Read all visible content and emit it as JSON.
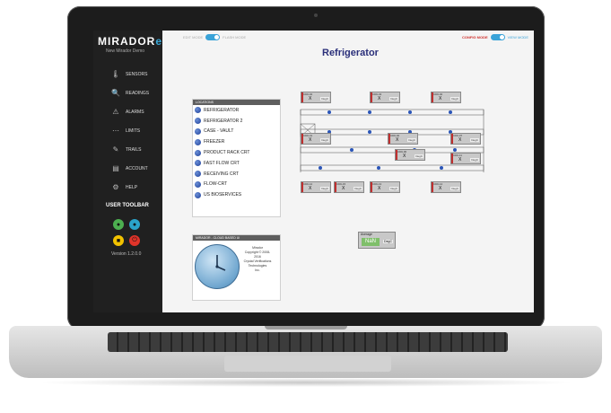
{
  "app": {
    "logo_left": "MIR",
    "logo_mid": "A",
    "logo_right": "DOR",
    "logo_e": "e",
    "subtitle": "New Mirador Demo"
  },
  "sidebar": {
    "items": [
      {
        "label": "SENSORS",
        "icon": "thermometer-icon"
      },
      {
        "label": "READINGS",
        "icon": "search-icon"
      },
      {
        "label": "ALARMS",
        "icon": "warning-icon"
      },
      {
        "label": "LIMITS",
        "icon": "limits-icon"
      },
      {
        "label": "TRAILS",
        "icon": "edit-icon"
      },
      {
        "label": "ACCOUNT",
        "icon": "account-icon"
      },
      {
        "label": "HELP",
        "icon": "help-icon"
      }
    ],
    "toolbar_title": "USER TOOLBAR",
    "version": "Version 1.2.0.0"
  },
  "topbar": {
    "left_toggle_off": "EDIT MODE",
    "left_toggle_on": "FLASH MODE",
    "config_label": "CONFIG MODE",
    "view_label": "VIEW MODE"
  },
  "page_title": "Refrigerator",
  "locations": {
    "header": "LOCATIONS",
    "items": [
      "REFRIGERATOR",
      "REFRIGERATOR 2",
      "CASE - VAULT",
      "FREEZER",
      "PRODUCT RACK CRT",
      "FAST FLOW CRT",
      "RECEIVING CRT",
      "FLOW-CRT",
      "US BIOSERVICES"
    ]
  },
  "info": {
    "header": "MIRADOR - CLOUD BASED UI",
    "line1": "Mirador",
    "line2": "Copyright © 2008-2016",
    "line3": "Crystal Verifications Technologies",
    "line4": "Inc."
  },
  "sensors": [
    {
      "name": "CDIL04",
      "value": "X",
      "unit": "DegC"
    },
    {
      "name": "CDIL43",
      "value": "X",
      "unit": "DegC"
    },
    {
      "name": "CDIL02",
      "value": "X",
      "unit": "DegC"
    },
    {
      "name": "CDIL41",
      "value": "X",
      "unit": "DegC"
    },
    {
      "name": "CDIL02",
      "value": "X",
      "unit": "DegC"
    },
    {
      "name": "CDIL07",
      "value": "X",
      "unit": "DegC"
    },
    {
      "name": "CDIL00",
      "value": "X",
      "unit": "DegC"
    },
    {
      "name": "CDIL11",
      "value": "X",
      "unit": "DegC"
    },
    {
      "name": "CDIL12",
      "value": "X",
      "unit": "DegC"
    },
    {
      "name": "CDIL13",
      "value": "X",
      "unit": "DegC"
    },
    {
      "name": "CDIL14",
      "value": "X",
      "unit": "DegC"
    },
    {
      "name": "CDIL15",
      "value": "X",
      "unit": "DegC"
    }
  ],
  "average": {
    "label": "Average",
    "value": "NaN",
    "unit": "DegC"
  },
  "colors": {
    "accent": "#3aa3d8",
    "config": "#d0322e",
    "sidebar": "#202020",
    "nan_green": "#7fbf6a"
  }
}
